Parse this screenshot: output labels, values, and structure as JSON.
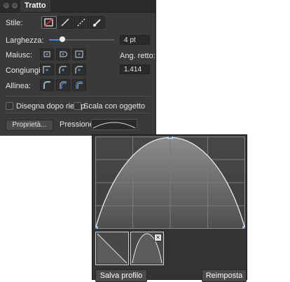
{
  "panel": {
    "tab_title": "Tratto",
    "stile_label": "Stile:",
    "larghezza_label": "Larghezza:",
    "larghezza_value": "4 pt",
    "larghezza_level": 0.2,
    "maiusc_label": "Maiusc:",
    "ang_retto_label": "Ang. retto:",
    "congiungi_label": "Congiungi:",
    "ang_value": "1.414",
    "allinea_label": "Allinea:",
    "disegna_label": "Disegna dopo riemp",
    "scala_label": "Scala con oggetto",
    "proprieta_label": "Proprietà...",
    "pressione_label": "Pressione:"
  },
  "popup": {
    "salva_label": "Salva profilo",
    "reimposta_label": "Reimposta"
  },
  "colors": {
    "panel_bg": "#3a3a3a",
    "accent": "#3b8de5",
    "graph_fill": "#8a8a8a",
    "handle": "#3b8de5"
  }
}
